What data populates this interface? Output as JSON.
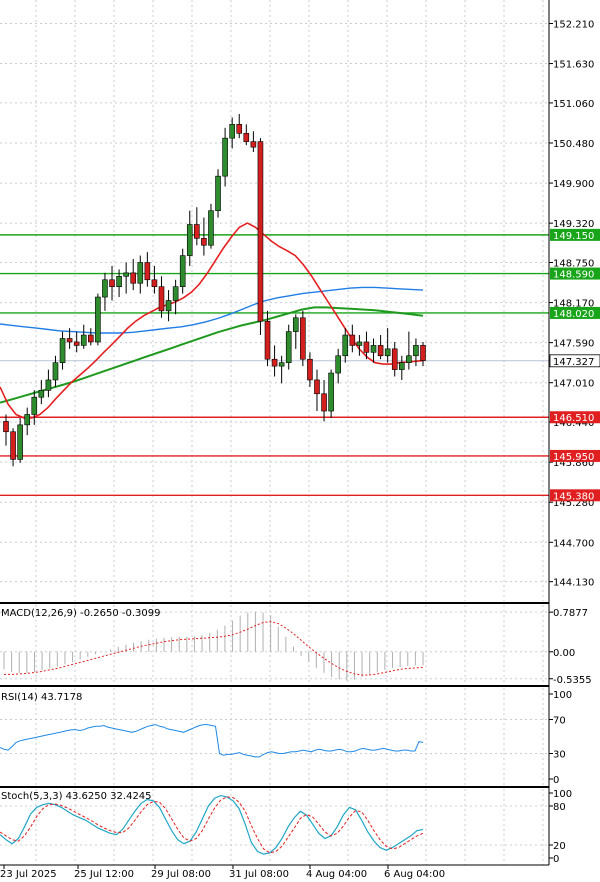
{
  "chart_data": {
    "type": "candlestick",
    "main": {
      "y_ticks": [
        "152.210",
        "151.630",
        "151.060",
        "150.480",
        "149.900",
        "149.320",
        "148.750",
        "148.170",
        "147.590",
        "147.010",
        "146.440",
        "145.860",
        "145.280",
        "144.700",
        "144.130"
      ],
      "ylim": [
        143.85,
        152.55
      ],
      "current_price": "147.327",
      "candles": [
        {
          "o": 146.45,
          "h": 146.55,
          "l": 146.1,
          "c": 146.3
        },
        {
          "o": 146.3,
          "h": 146.35,
          "l": 145.8,
          "c": 145.9
        },
        {
          "o": 145.9,
          "h": 146.5,
          "l": 145.85,
          "c": 146.4
        },
        {
          "o": 146.4,
          "h": 146.65,
          "l": 146.25,
          "c": 146.55
        },
        {
          "o": 146.55,
          "h": 146.9,
          "l": 146.4,
          "c": 146.8
        },
        {
          "o": 146.8,
          "h": 147.05,
          "l": 146.7,
          "c": 146.9
        },
        {
          "o": 146.9,
          "h": 147.2,
          "l": 146.8,
          "c": 147.05
        },
        {
          "o": 147.05,
          "h": 147.4,
          "l": 146.95,
          "c": 147.3
        },
        {
          "o": 147.3,
          "h": 147.75,
          "l": 147.2,
          "c": 147.65
        },
        {
          "o": 147.65,
          "h": 147.8,
          "l": 147.5,
          "c": 147.6
        },
        {
          "o": 147.6,
          "h": 147.75,
          "l": 147.45,
          "c": 147.55
        },
        {
          "o": 147.55,
          "h": 147.85,
          "l": 147.5,
          "c": 147.7
        },
        {
          "o": 147.7,
          "h": 147.8,
          "l": 147.55,
          "c": 147.6
        },
        {
          "o": 147.6,
          "h": 148.3,
          "l": 147.55,
          "c": 148.25
        },
        {
          "o": 148.25,
          "h": 148.6,
          "l": 148.05,
          "c": 148.5
        },
        {
          "o": 148.5,
          "h": 148.7,
          "l": 148.2,
          "c": 148.4
        },
        {
          "o": 148.4,
          "h": 148.65,
          "l": 148.25,
          "c": 148.55
        },
        {
          "o": 148.55,
          "h": 148.75,
          "l": 148.3,
          "c": 148.6
        },
        {
          "o": 148.6,
          "h": 148.8,
          "l": 148.35,
          "c": 148.45
        },
        {
          "o": 148.45,
          "h": 148.85,
          "l": 148.3,
          "c": 148.75
        },
        {
          "o": 148.75,
          "h": 148.9,
          "l": 148.4,
          "c": 148.5
        },
        {
          "o": 148.5,
          "h": 148.7,
          "l": 148.3,
          "c": 148.4
        },
        {
          "o": 148.4,
          "h": 148.55,
          "l": 147.95,
          "c": 148.05
        },
        {
          "o": 148.05,
          "h": 148.35,
          "l": 147.9,
          "c": 148.2
        },
        {
          "o": 148.2,
          "h": 148.5,
          "l": 148.0,
          "c": 148.4
        },
        {
          "o": 148.4,
          "h": 148.95,
          "l": 148.3,
          "c": 148.85
        },
        {
          "o": 148.85,
          "h": 149.5,
          "l": 148.7,
          "c": 149.3
        },
        {
          "o": 149.3,
          "h": 149.55,
          "l": 149.0,
          "c": 149.1
        },
        {
          "o": 149.1,
          "h": 149.4,
          "l": 148.85,
          "c": 149.0
        },
        {
          "o": 149.0,
          "h": 149.6,
          "l": 148.95,
          "c": 149.5
        },
        {
          "o": 149.5,
          "h": 150.1,
          "l": 149.4,
          "c": 150.0
        },
        {
          "o": 150.0,
          "h": 150.7,
          "l": 149.85,
          "c": 150.55
        },
        {
          "o": 150.55,
          "h": 150.85,
          "l": 150.4,
          "c": 150.75
        },
        {
          "o": 150.75,
          "h": 150.9,
          "l": 150.55,
          "c": 150.62
        },
        {
          "o": 150.62,
          "h": 150.75,
          "l": 150.45,
          "c": 150.5
        },
        {
          "o": 150.5,
          "h": 150.65,
          "l": 150.35,
          "c": 150.42
        },
        {
          "o": 150.5,
          "h": 150.55,
          "l": 147.7,
          "c": 147.9
        },
        {
          "o": 147.9,
          "h": 148.05,
          "l": 147.25,
          "c": 147.35
        },
        {
          "o": 147.35,
          "h": 147.55,
          "l": 147.1,
          "c": 147.25
        },
        {
          "o": 147.25,
          "h": 147.4,
          "l": 147.0,
          "c": 147.3
        },
        {
          "o": 147.3,
          "h": 147.85,
          "l": 147.2,
          "c": 147.75
        },
        {
          "o": 147.75,
          "h": 148.0,
          "l": 147.5,
          "c": 147.95
        },
        {
          "o": 147.95,
          "h": 148.05,
          "l": 147.25,
          "c": 147.35
        },
        {
          "o": 147.35,
          "h": 147.45,
          "l": 146.95,
          "c": 147.05
        },
        {
          "o": 147.05,
          "h": 147.2,
          "l": 146.6,
          "c": 146.85
        },
        {
          "o": 146.85,
          "h": 147.05,
          "l": 146.45,
          "c": 146.6
        },
        {
          "o": 146.6,
          "h": 147.2,
          "l": 146.5,
          "c": 147.15
        },
        {
          "o": 147.15,
          "h": 147.5,
          "l": 147.0,
          "c": 147.4
        },
        {
          "o": 147.4,
          "h": 147.8,
          "l": 147.3,
          "c": 147.7
        },
        {
          "o": 147.7,
          "h": 147.85,
          "l": 147.45,
          "c": 147.55
        },
        {
          "o": 147.55,
          "h": 147.7,
          "l": 147.4,
          "c": 147.6
        },
        {
          "o": 147.6,
          "h": 147.75,
          "l": 147.35,
          "c": 147.45
        },
        {
          "o": 147.45,
          "h": 147.65,
          "l": 147.3,
          "c": 147.55
        },
        {
          "o": 147.55,
          "h": 147.7,
          "l": 147.35,
          "c": 147.4
        },
        {
          "o": 147.4,
          "h": 147.8,
          "l": 147.3,
          "c": 147.5
        },
        {
          "o": 147.5,
          "h": 147.6,
          "l": 147.1,
          "c": 147.2
        },
        {
          "o": 147.2,
          "h": 147.4,
          "l": 147.05,
          "c": 147.3
        },
        {
          "o": 147.3,
          "h": 147.75,
          "l": 147.2,
          "c": 147.4
        },
        {
          "o": 147.4,
          "h": 147.65,
          "l": 147.25,
          "c": 147.55
        },
        {
          "o": 147.55,
          "h": 147.6,
          "l": 147.25,
          "c": 147.33
        }
      ],
      "ma_fast": [
        146.95,
        146.7,
        146.55,
        146.5,
        146.5,
        146.55,
        146.65,
        146.78,
        146.9,
        147.02,
        147.12,
        147.22,
        147.33,
        147.45,
        147.56,
        147.68,
        147.8,
        147.9,
        147.98,
        148.04,
        148.1,
        148.14,
        148.18,
        148.24,
        148.32,
        148.44,
        148.6,
        148.78,
        148.96,
        149.12,
        149.26,
        149.32,
        149.26,
        149.16,
        149.06,
        148.98,
        148.92,
        148.85,
        148.72,
        148.56,
        148.38,
        148.2,
        148.02,
        147.84,
        147.66,
        147.5,
        147.38,
        147.3,
        147.28,
        147.28,
        147.3,
        147.31,
        147.32,
        147.33
      ],
      "ma_slow": [
        146.72,
        146.77,
        146.82,
        146.87,
        146.92,
        146.97,
        147.02,
        147.08,
        147.14,
        147.2,
        147.26,
        147.32,
        147.38,
        147.44,
        147.5,
        147.56,
        147.62,
        147.68,
        147.74,
        147.79,
        147.84,
        147.88,
        147.92,
        147.97,
        148.02,
        148.07,
        148.1,
        148.1,
        148.09,
        148.08,
        148.07,
        148.06,
        148.04,
        148.02,
        148.0,
        147.98
      ],
      "ma_blue": [
        147.86,
        147.84,
        147.82,
        147.8,
        147.78,
        147.76,
        147.75,
        147.74,
        147.73,
        147.73,
        147.73,
        147.74,
        147.76,
        147.78,
        147.8,
        147.82,
        147.85,
        147.89,
        147.94,
        148.0,
        148.07,
        148.14,
        148.2,
        148.24,
        148.27,
        148.3,
        148.32,
        148.34,
        148.36,
        148.38,
        148.39,
        148.39,
        148.38,
        148.37,
        148.36,
        148.35
      ],
      "levels": [
        {
          "label": "149.150",
          "value": 149.15,
          "color": "#19a519"
        },
        {
          "label": "148.590",
          "value": 148.59,
          "color": "#19a519"
        },
        {
          "label": "148.020",
          "value": 148.02,
          "color": "#19a519"
        },
        {
          "label": "146.510",
          "value": 146.51,
          "color": "#e02020"
        },
        {
          "label": "145.950",
          "value": 145.95,
          "color": "#e02020"
        },
        {
          "label": "145.380",
          "value": 145.38,
          "color": "#e02020"
        }
      ]
    },
    "macd": {
      "label": "MACD(12,26,9) -0.2650 -0.3099",
      "y_ticks": [
        "0.7877",
        "0.00",
        "-0.5355"
      ],
      "ylim": [
        -0.6,
        0.85
      ],
      "histogram": [
        -0.35,
        -0.4,
        -0.42,
        -0.42,
        -0.4,
        -0.37,
        -0.33,
        -0.29,
        -0.25,
        -0.2,
        -0.15,
        -0.1,
        -0.05,
        0.0,
        0.05,
        0.1,
        0.14,
        0.18,
        0.21,
        0.24,
        0.26,
        0.28,
        0.29,
        0.3,
        0.3,
        0.31,
        0.33,
        0.37,
        0.44,
        0.52,
        0.62,
        0.72,
        0.78,
        0.8,
        0.78,
        0.72,
        0.5,
        0.3,
        0.1,
        -0.08,
        -0.2,
        -0.32,
        -0.42,
        -0.5,
        -0.55,
        -0.57,
        -0.55,
        -0.5,
        -0.45,
        -0.4,
        -0.36,
        -0.32,
        -0.3,
        -0.28,
        -0.27,
        -0.27
      ],
      "signal": [
        -0.45,
        -0.45,
        -0.44,
        -0.43,
        -0.41,
        -0.39,
        -0.36,
        -0.33,
        -0.29,
        -0.25,
        -0.21,
        -0.17,
        -0.13,
        -0.09,
        -0.05,
        -0.01,
        0.03,
        0.07,
        0.11,
        0.14,
        0.17,
        0.2,
        0.22,
        0.24,
        0.25,
        0.26,
        0.27,
        0.28,
        0.29,
        0.31,
        0.34,
        0.39,
        0.45,
        0.52,
        0.58,
        0.6,
        0.56,
        0.47,
        0.36,
        0.23,
        0.1,
        -0.02,
        -0.13,
        -0.23,
        -0.32,
        -0.39,
        -0.44,
        -0.46,
        -0.46,
        -0.44,
        -0.41,
        -0.38,
        -0.35,
        -0.33,
        -0.32,
        -0.31
      ]
    },
    "rsi": {
      "label": "RSI(14) 43.7178",
      "y_ticks": [
        "100",
        "70",
        "30",
        "0"
      ],
      "ylim": [
        0,
        100
      ],
      "values": [
        37,
        35,
        34,
        38,
        43,
        45,
        46,
        47,
        48,
        49,
        50,
        51,
        52,
        53,
        54,
        55,
        56,
        57,
        58,
        58,
        57,
        58,
        60,
        61,
        62,
        62,
        63,
        61,
        60,
        59,
        58,
        57,
        56,
        55,
        56,
        58,
        60,
        62,
        63,
        64,
        62,
        61,
        59,
        58,
        57,
        56,
        55,
        57,
        59,
        61,
        63,
        64,
        64,
        63,
        62,
        30,
        28,
        29,
        29,
        30,
        31,
        29,
        28,
        27,
        26,
        26,
        29,
        31,
        32,
        31,
        30,
        30,
        31,
        32,
        32,
        33,
        34,
        33,
        32,
        34,
        35,
        34,
        33,
        33,
        34,
        35,
        34,
        32,
        32,
        33,
        35,
        36,
        35,
        34,
        34,
        35,
        36,
        35,
        34,
        33,
        33,
        34,
        34,
        33,
        33,
        44,
        43
      ]
    },
    "stoch": {
      "label": "Stoch(5,3,3) 43.6250 32.4245",
      "y_ticks": [
        "100",
        "80",
        "20",
        "0"
      ],
      "ylim": [
        0,
        100
      ],
      "k": [
        36,
        28,
        22,
        30,
        48,
        68,
        78,
        82,
        84,
        82,
        78,
        72,
        66,
        62,
        58,
        52,
        46,
        42,
        38,
        36,
        44,
        58,
        72,
        84,
        90,
        88,
        78,
        60,
        42,
        28,
        22,
        26,
        40,
        60,
        80,
        92,
        96,
        94,
        88,
        76,
        52,
        24,
        10,
        6,
        8,
        16,
        30,
        48,
        62,
        72,
        66,
        52,
        38,
        30,
        34,
        48,
        66,
        78,
        74,
        58,
        40,
        26,
        16,
        12,
        16,
        22,
        28,
        34,
        42,
        44
      ],
      "d": [
        40,
        34,
        28,
        26,
        34,
        48,
        64,
        76,
        82,
        83,
        81,
        77,
        72,
        67,
        62,
        57,
        51,
        46,
        42,
        39,
        39,
        46,
        58,
        71,
        82,
        87,
        86,
        76,
        60,
        44,
        31,
        26,
        30,
        42,
        60,
        77,
        89,
        94,
        93,
        86,
        72,
        50,
        30,
        14,
        8,
        10,
        18,
        32,
        46,
        61,
        67,
        63,
        52,
        40,
        34,
        38,
        49,
        63,
        73,
        71,
        58,
        42,
        28,
        18,
        14,
        16,
        22,
        28,
        34,
        38
      ]
    },
    "x_tick_labels": [
      "23 Jul 2025",
      "25 Jul 12:00",
      "29 Jul 08:00",
      "31 Jul 08:00",
      "4 Aug 04:00",
      "6 Aug 04:00"
    ]
  }
}
